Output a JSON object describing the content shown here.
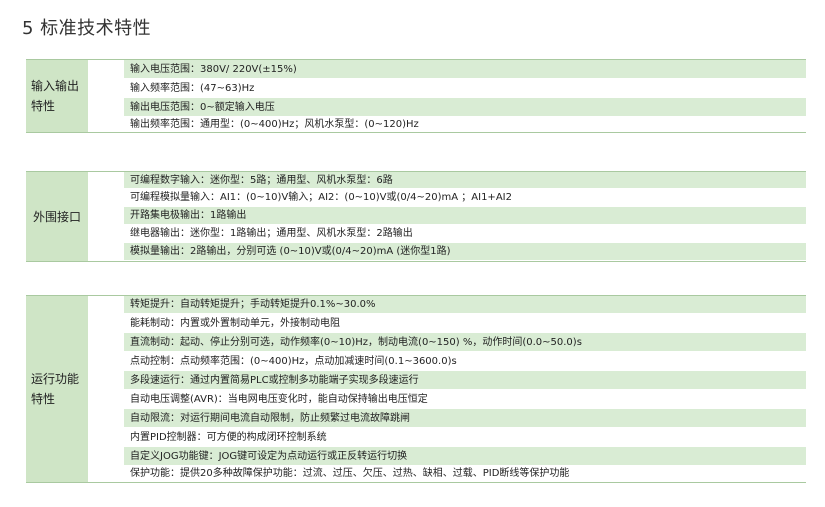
{
  "title": "5 标准技术特性",
  "sections": [
    {
      "label": "输入输出特性",
      "rows": [
        "输入电压范围：380V/ 220V(±15%)",
        "输入频率范围：(47~63)Hz",
        "输出电压范围：0~额定输入电压",
        "输出频率范围：通用型：(0~400)Hz；风机水泵型：(0~120)Hz"
      ]
    },
    {
      "label": "外围接口",
      "rows": [
        "可编程数字输入：迷你型：5路；通用型、风机水泵型：6路",
        "可编程模拟量输入：AI1：(0~10)V输入；AI2：(0~10)V或(0/4~20)mA ；AI1+AI2",
        "开路集电极输出：1路输出",
        "继电器输出：迷你型：1路输出；通用型、风机水泵型：2路输出",
        "模拟量输出：2路输出，分别可选 (0~10)V或(0/4~20)mA (迷你型1路)"
      ]
    },
    {
      "label": "运行功能特性",
      "rows": [
        "转矩提升：自动转矩提升；手动转矩提升0.1%~30.0%",
        "能耗制动：内置或外置制动单元，外接制动电阻",
        "直流制动：起动、停止分别可选，动作频率(0~10)Hz，制动电流(0~150) %，动作时间(0.0~50.0)s",
        "点动控制：点动频率范围：(0~400)Hz，点动加减速时间(0.1~3600.0)s",
        "多段速运行：通过内置简易PLC或控制多功能端子实现多段速运行",
        "自动电压调整(AVR)：当电网电压变化时，能自动保持输出电压恒定",
        "自动限流：对运行期间电流自动限制，防止频繁过电流故障跳闸",
        "内置PID控制器：可方便的构成闭环控制系统",
        "自定义JOG功能键：JOG键可设定为点动运行或正反转运行切换",
        "保护功能：提供20多种故障保护功能：过流、过压、欠压、过热、缺相、过载、PID断线等保护功能"
      ]
    }
  ]
}
